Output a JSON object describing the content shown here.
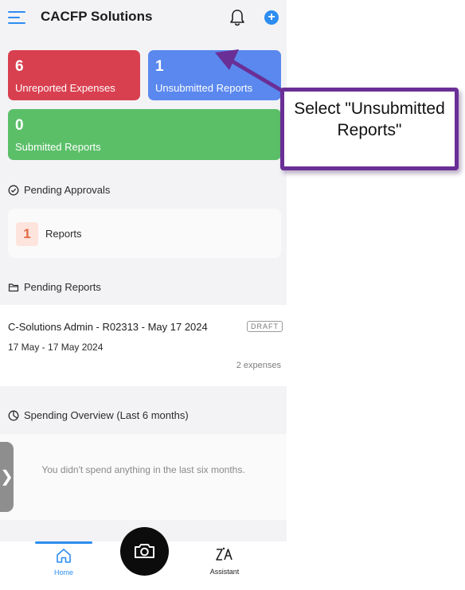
{
  "header": {
    "title": "CACFP Solutions",
    "add_symbol": "+"
  },
  "summary_cards": {
    "unreported": {
      "count": "6",
      "label": "Unreported Expenses",
      "color": "#d9404f"
    },
    "unsubmitted": {
      "count": "1",
      "label": "Unsubmitted Reports",
      "color": "#5a88ee"
    },
    "submitted": {
      "count": "0",
      "label": "Submitted Reports",
      "color": "#5bbf68"
    }
  },
  "pending_approvals": {
    "title": "Pending Approvals",
    "count": "1",
    "label": "Reports"
  },
  "pending_reports": {
    "title": "Pending Reports",
    "items": [
      {
        "title": "C-Solutions Admin - R02313 -  May 17 2024",
        "status": "DRAFT",
        "dates": "17 May - 17 May 2024",
        "expenses": "2 expenses"
      }
    ]
  },
  "spending_overview": {
    "title": "Spending Overview (Last 6 months)",
    "empty_message": "You didn't spend anything in the last six months."
  },
  "side_handle": {
    "symbol": "❯"
  },
  "bottom_nav": {
    "items": [
      {
        "label": "Home",
        "icon": "home-icon",
        "active": true
      },
      {
        "label": "Assistant",
        "icon": "assistant-icon",
        "active": false
      }
    ],
    "camera_icon": "camera-icon"
  },
  "callout": {
    "text": "Select \"Unsubmitted Reports\"",
    "border_color": "#6a2f96"
  },
  "accent_color": "#2d8df0"
}
